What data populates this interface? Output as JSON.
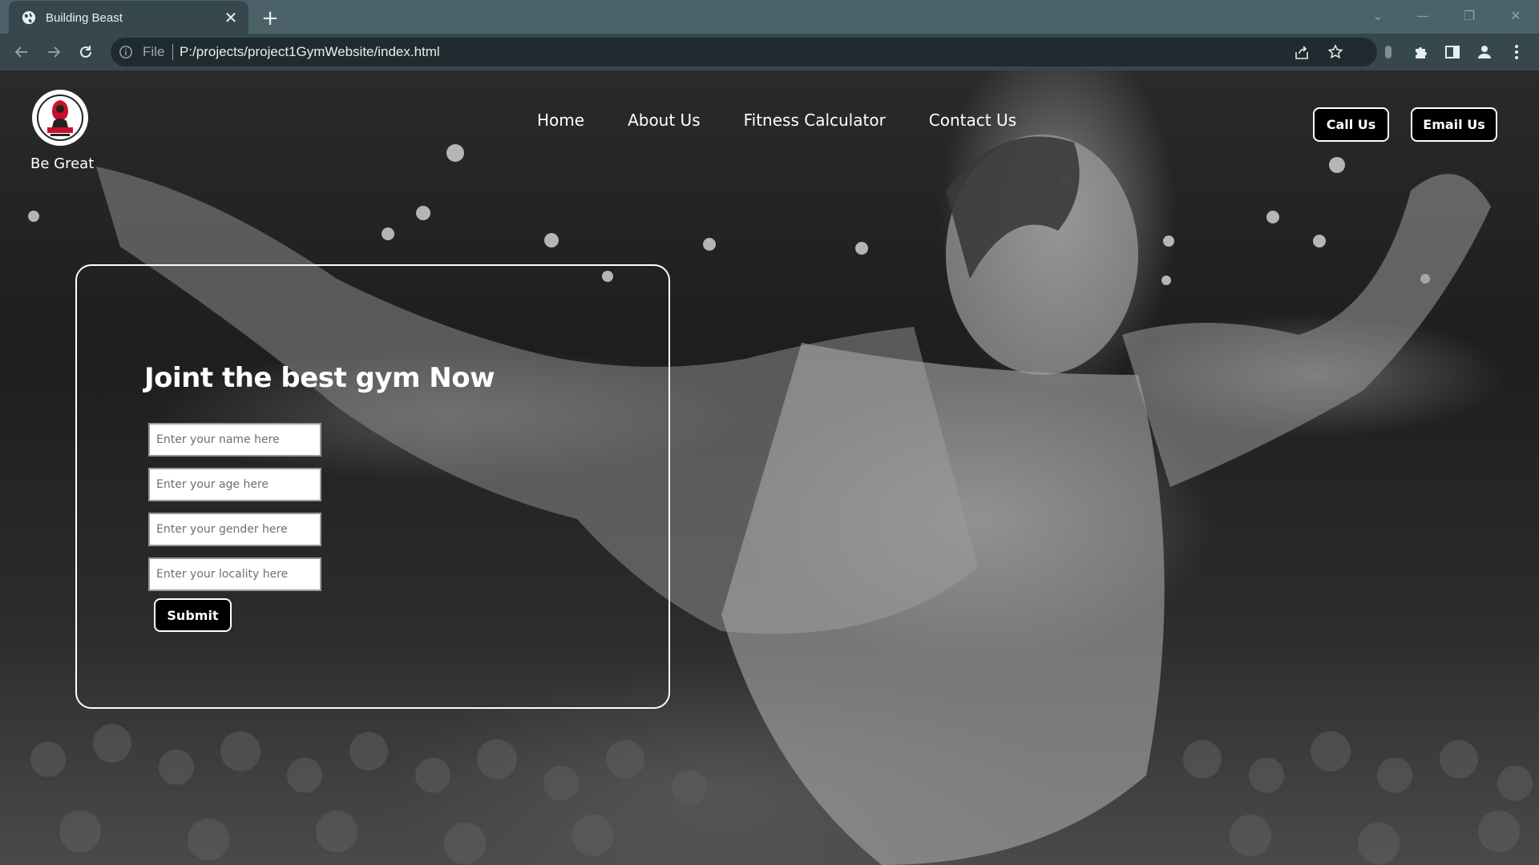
{
  "browser": {
    "tab_title": "Building Beast",
    "address_scheme_label": "File",
    "url": "P:/projects/project1GymWebsite/index.html",
    "icons": [
      "globe-icon",
      "close-icon",
      "plus-icon",
      "back-icon",
      "forward-icon",
      "reload-icon",
      "info-icon",
      "share-icon",
      "star-icon",
      "extension-icon",
      "puzzle-icon",
      "side-panel-icon",
      "profile-icon",
      "menu-dots-icon"
    ]
  },
  "site": {
    "brand": {
      "tagline": "Be Great"
    },
    "nav": [
      "Home",
      "About Us",
      "Fitness Calculator",
      "Contact Us"
    ],
    "actions": {
      "call_label": "Call Us",
      "email_label": "Email Us"
    },
    "signup": {
      "heading": "Joint the best gym Now",
      "fields": {
        "name_placeholder": "Enter your name here",
        "age_placeholder": "Enter your age here",
        "gender_placeholder": "Enter your gender here",
        "locality_placeholder": "Enter your locality here"
      },
      "submit_label": "Submit"
    }
  },
  "colors": {
    "tabbar_bg": "#4b6269",
    "toolbar_bg": "#36474d",
    "omnibox_bg": "#1f2b2f",
    "text_on_dark": "#ffffff",
    "button_bg": "#000000"
  }
}
